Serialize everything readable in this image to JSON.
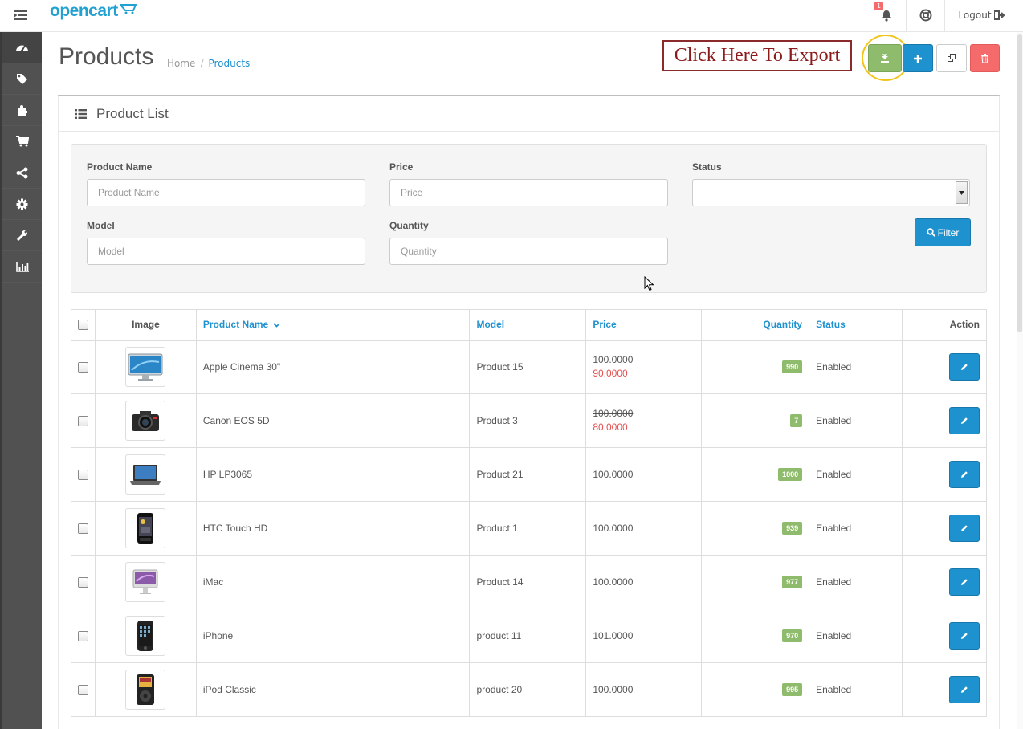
{
  "header": {
    "logo_text": "opencart",
    "notification_count": "1",
    "logout_label": "Logout"
  },
  "sidebar": {
    "items": [
      {
        "icon": "dashboard-icon"
      },
      {
        "icon": "tags-icon"
      },
      {
        "icon": "puzzle-icon"
      },
      {
        "icon": "shopping-cart-icon"
      },
      {
        "icon": "share-icon"
      },
      {
        "icon": "gear-icon"
      },
      {
        "icon": "wrench-icon"
      },
      {
        "icon": "bar-chart-icon"
      }
    ]
  },
  "page": {
    "title": "Products",
    "breadcrumb": [
      "Home",
      "Products"
    ],
    "export_callout": "Click Here To Export"
  },
  "panel": {
    "title": "Product List"
  },
  "filter": {
    "product_name_label": "Product Name",
    "product_name_placeholder": "Product Name",
    "price_label": "Price",
    "price_placeholder": "Price",
    "status_label": "Status",
    "status_value": "",
    "model_label": "Model",
    "model_placeholder": "Model",
    "quantity_label": "Quantity",
    "quantity_placeholder": "Quantity",
    "filter_button": "Filter"
  },
  "table": {
    "headers": {
      "image": "Image",
      "product_name": "Product Name",
      "model": "Model",
      "price": "Price",
      "quantity": "Quantity",
      "status": "Status",
      "action": "Action"
    },
    "rows": [
      {
        "name": "Apple Cinema 30\"",
        "model": "Product 15",
        "price": "100.0000",
        "special": "90.0000",
        "quantity": "990",
        "status": "Enabled",
        "thumb": "monitor"
      },
      {
        "name": "Canon EOS 5D",
        "model": "Product 3",
        "price": "100.0000",
        "special": "80.0000",
        "quantity": "7",
        "status": "Enabled",
        "thumb": "camera"
      },
      {
        "name": "HP LP3065",
        "model": "Product 21",
        "price": "100.0000",
        "special": "",
        "quantity": "1000",
        "status": "Enabled",
        "thumb": "laptop"
      },
      {
        "name": "HTC Touch HD",
        "model": "Product 1",
        "price": "100.0000",
        "special": "",
        "quantity": "939",
        "status": "Enabled",
        "thumb": "phone"
      },
      {
        "name": "iMac",
        "model": "Product 14",
        "price": "100.0000",
        "special": "",
        "quantity": "977",
        "status": "Enabled",
        "thumb": "imac"
      },
      {
        "name": "iPhone",
        "model": "product 11",
        "price": "101.0000",
        "special": "",
        "quantity": "970",
        "status": "Enabled",
        "thumb": "iphone"
      },
      {
        "name": "iPod Classic",
        "model": "product 20",
        "price": "100.0000",
        "special": "",
        "quantity": "995",
        "status": "Enabled",
        "thumb": "ipod"
      }
    ]
  },
  "colors": {
    "primary": "#1e91cf",
    "success": "#8fbb6c",
    "danger": "#f56b6b",
    "sidebar": "#515151"
  }
}
